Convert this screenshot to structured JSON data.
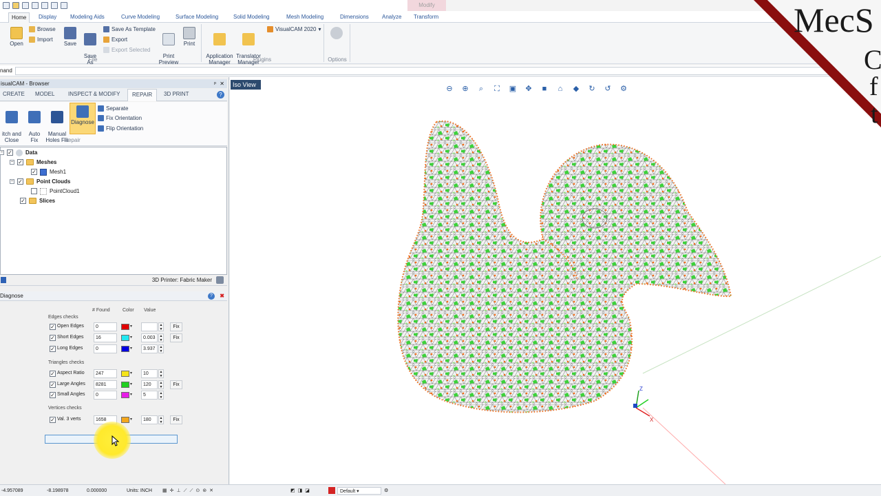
{
  "menu": {
    "context_tab": "Modify",
    "tabs": [
      "Home",
      "Display",
      "Modeling Aids",
      "Curve Modeling",
      "Surface Modeling",
      "Solid Modeling",
      "Mesh Modeling",
      "Dimensions",
      "Analyze",
      "Transform"
    ]
  },
  "ribbon": {
    "open": "Open",
    "browse": "Browse",
    "import": "Import",
    "save": "Save",
    "save_as": "Save\nAs",
    "save_as_template": "Save As Template",
    "export": "Export",
    "export_selected": "Export Selected",
    "print_preview": "Print\nPreview",
    "print": "Print",
    "file_group": "File",
    "app_manager": "Application\nManager",
    "translator_manager": "Translator\nManager",
    "visualcam": "VisualCAM 2020",
    "plugins_group": "Plugins",
    "options_group": "Options"
  },
  "command": {
    "label": "nand"
  },
  "browser": {
    "title": "isualCAM - Browser",
    "tabs": [
      "CREATE",
      "MODEL",
      "INSPECT & MODIFY",
      "REPAIR",
      "3D PRINT"
    ],
    "repair": {
      "stitch": "itch and\nClose",
      "auto_fix": "Auto\nFix",
      "manual_holes": "Manual\nHoles Fix",
      "diagnose": "Diagnose",
      "separate": "Separate",
      "fix_orientation": "Fix Orientation",
      "flip_orientation": "Flip Orientation",
      "group": "Repair"
    },
    "tree": {
      "data": "Data",
      "meshes": "Meshes",
      "mesh1": "Mesh1",
      "point_clouds": "Point Clouds",
      "pointcloud1": "PointCloud1",
      "slices": "Slices"
    },
    "printer": "3D Printer: Fabric Maker"
  },
  "diagnose": {
    "title": "Diagnose",
    "headers": {
      "found": "# Found",
      "color": "Color",
      "value": "Value"
    },
    "edges_label": "Edges checks",
    "triangles_label": "Triangles checks",
    "vertices_label": "Vertices checks",
    "fix": "Fix",
    "run": "Run Checks",
    "rows": [
      {
        "label": "Open Edges",
        "found": "0",
        "color": "#e00000",
        "value": "",
        "fix": true
      },
      {
        "label": "Short Edges",
        "found": "16",
        "color": "#22e8f0",
        "value": "0.003",
        "fix": true
      },
      {
        "label": "Long Edges",
        "found": "0",
        "color": "#0000e0",
        "value": "3.937",
        "fix": false
      },
      {
        "label": "Aspect Ratio",
        "found": "247",
        "color": "#f5e41a",
        "value": "10",
        "fix": false
      },
      {
        "label": "Large Angles",
        "found": "8281",
        "color": "#20d020",
        "value": "120",
        "fix": true
      },
      {
        "label": "Small Angles",
        "found": "0",
        "color": "#e81ce8",
        "value": "5",
        "fix": false
      },
      {
        "label": "Val. 3 verts",
        "found": "1658",
        "color": "#f4a71c",
        "value": "180",
        "fix": true
      }
    ]
  },
  "viewport": {
    "label": "Iso View",
    "axes": {
      "z": "Z",
      "x": "X"
    }
  },
  "status": {
    "x": "-4.957089",
    "y": "-8.198978",
    "z": "0.000000",
    "units": "Units: INCH",
    "layer": "Default"
  },
  "watermark": {
    "text": "MecS"
  }
}
